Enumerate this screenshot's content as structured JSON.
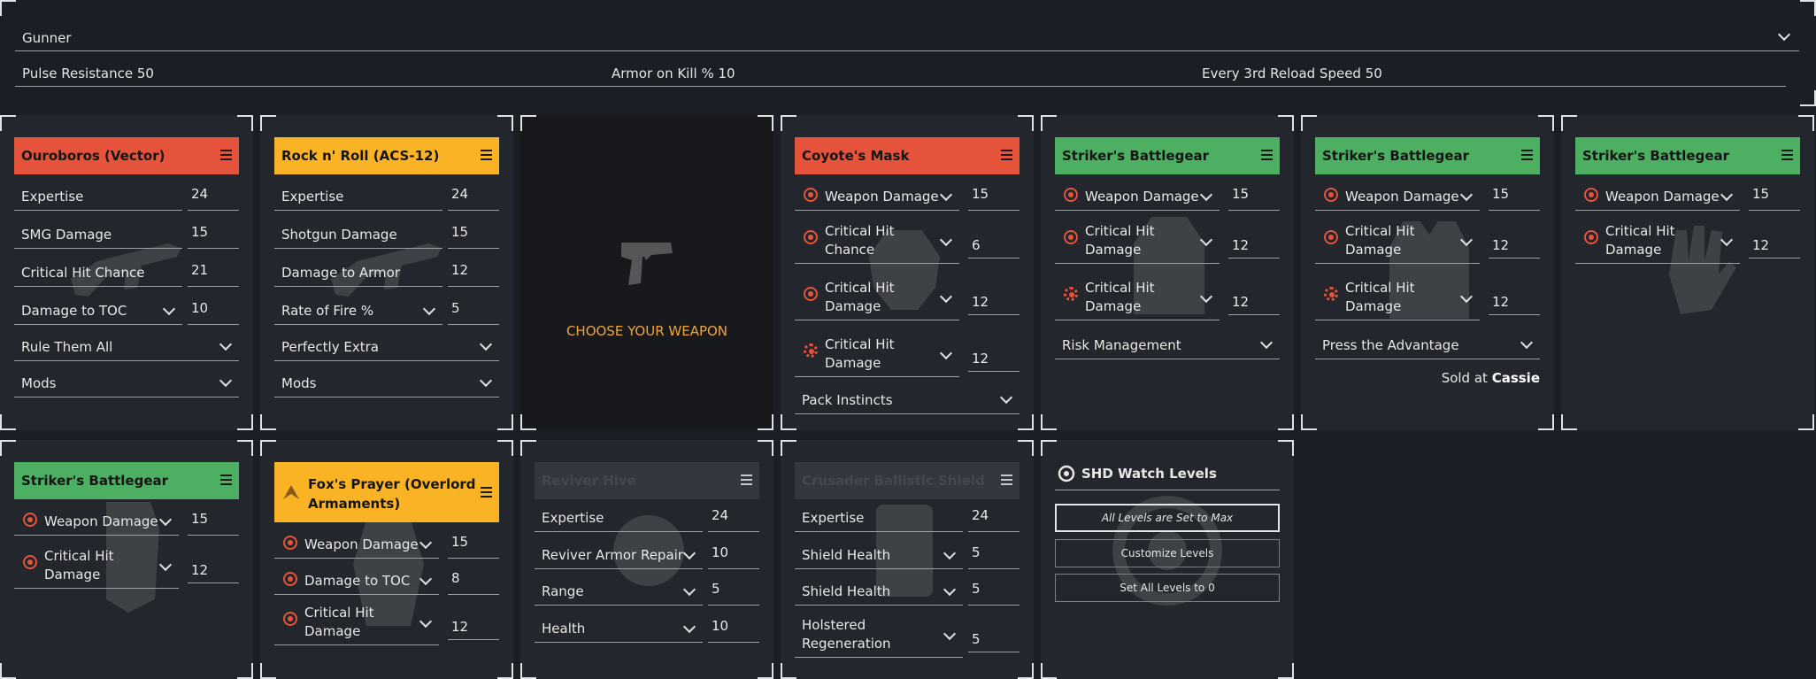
{
  "spec": {
    "selected": "Gunner"
  },
  "spec_stats": [
    "Pulse Resistance 50",
    "Armor on Kill % 10",
    "Every 3rd Reload Speed 50"
  ],
  "colors": {
    "red": "#e5533a",
    "orange": "#fbb326",
    "green": "#4caf62",
    "choose": "#f2a33a"
  },
  "weapons": {
    "primary": {
      "title": "Ouroboros (Vector)",
      "attrs": [
        {
          "label": "Expertise",
          "value": "24"
        },
        {
          "label": "SMG Damage",
          "value": "15"
        },
        {
          "label": "Critical Hit Chance",
          "value": "21"
        },
        {
          "label": "Damage to TOC",
          "value": "10"
        }
      ],
      "talent": "Rule Them All",
      "mods": "Mods",
      "icon": "smg-watermark-icon"
    },
    "secondary": {
      "title": "Rock n' Roll (ACS-12)",
      "attrs": [
        {
          "label": "Expertise",
          "value": "24"
        },
        {
          "label": "Shotgun Damage",
          "value": "15"
        },
        {
          "label": "Damage to Armor",
          "value": "12"
        },
        {
          "label": "Rate of Fire %",
          "value": "5"
        }
      ],
      "talent": "Perfectly Extra",
      "mods": "Mods",
      "icon": "shotgun-watermark-icon"
    },
    "sidearm": {
      "choose": "CHOOSE YOUR WEAPON",
      "icon": "pistol-icon"
    }
  },
  "gear": {
    "mask": {
      "title": "Coyote's Mask",
      "attrs": [
        {
          "label": "Weapon Damage",
          "value": "15"
        },
        {
          "label": "Critical Hit Chance",
          "value": "6"
        },
        {
          "label": "Critical Hit Damage",
          "value": "12"
        },
        {
          "label": "Critical Hit Damage",
          "value": "12"
        }
      ],
      "talent": "Pack Instincts"
    },
    "backpack": {
      "title": "Striker's Battlegear",
      "attrs": [
        {
          "label": "Weapon Damage",
          "value": "15"
        },
        {
          "label": "Critical Hit Damage",
          "value": "12"
        },
        {
          "label": "Critical Hit Damage",
          "value": "12"
        }
      ],
      "talent": "Risk Management"
    },
    "chest": {
      "title": "Striker's Battlegear",
      "attrs": [
        {
          "label": "Weapon Damage",
          "value": "15"
        },
        {
          "label": "Critical Hit Damage",
          "value": "12"
        },
        {
          "label": "Critical Hit Damage",
          "value": "12"
        }
      ],
      "talent": "Press the Advantage",
      "sold_prefix": "Sold at ",
      "sold_vendor": "Cassie"
    },
    "gloves": {
      "title": "Striker's Battlegear",
      "attrs": [
        {
          "label": "Weapon Damage",
          "value": "15"
        },
        {
          "label": "Critical Hit Damage",
          "value": "12"
        }
      ]
    },
    "holster": {
      "title": "Striker's Battlegear",
      "attrs": [
        {
          "label": "Weapon Damage",
          "value": "15"
        },
        {
          "label": "Critical Hit Damage",
          "value": "12"
        }
      ]
    },
    "kneepads": {
      "title": "Fox's Prayer (Overlord Armaments)",
      "attrs": [
        {
          "label": "Weapon Damage",
          "value": "15"
        },
        {
          "label": "Damage to TOC",
          "value": "8"
        },
        {
          "label": "Critical Hit Damage",
          "value": "12"
        }
      ]
    }
  },
  "skills": {
    "skill1": {
      "title": "Reviver Hive",
      "attrs": [
        {
          "label": "Expertise",
          "value": "24"
        },
        {
          "label": "Reviver Armor Repair",
          "value": "10"
        },
        {
          "label": "Range",
          "value": "5"
        },
        {
          "label": "Health",
          "value": "10"
        }
      ]
    },
    "skill2": {
      "title": "Crusader Ballistic Shield",
      "attrs": [
        {
          "label": "Expertise",
          "value": "24"
        },
        {
          "label": "Shield Health",
          "value": "5"
        },
        {
          "label": "Shield Health",
          "value": "5"
        },
        {
          "label": "Holstered Regeneration",
          "value": "5"
        }
      ]
    }
  },
  "shd": {
    "title": "SHD Watch Levels",
    "buttons": [
      "All Levels are Set to Max",
      "Customize Levels",
      "Set All Levels to 0"
    ]
  }
}
